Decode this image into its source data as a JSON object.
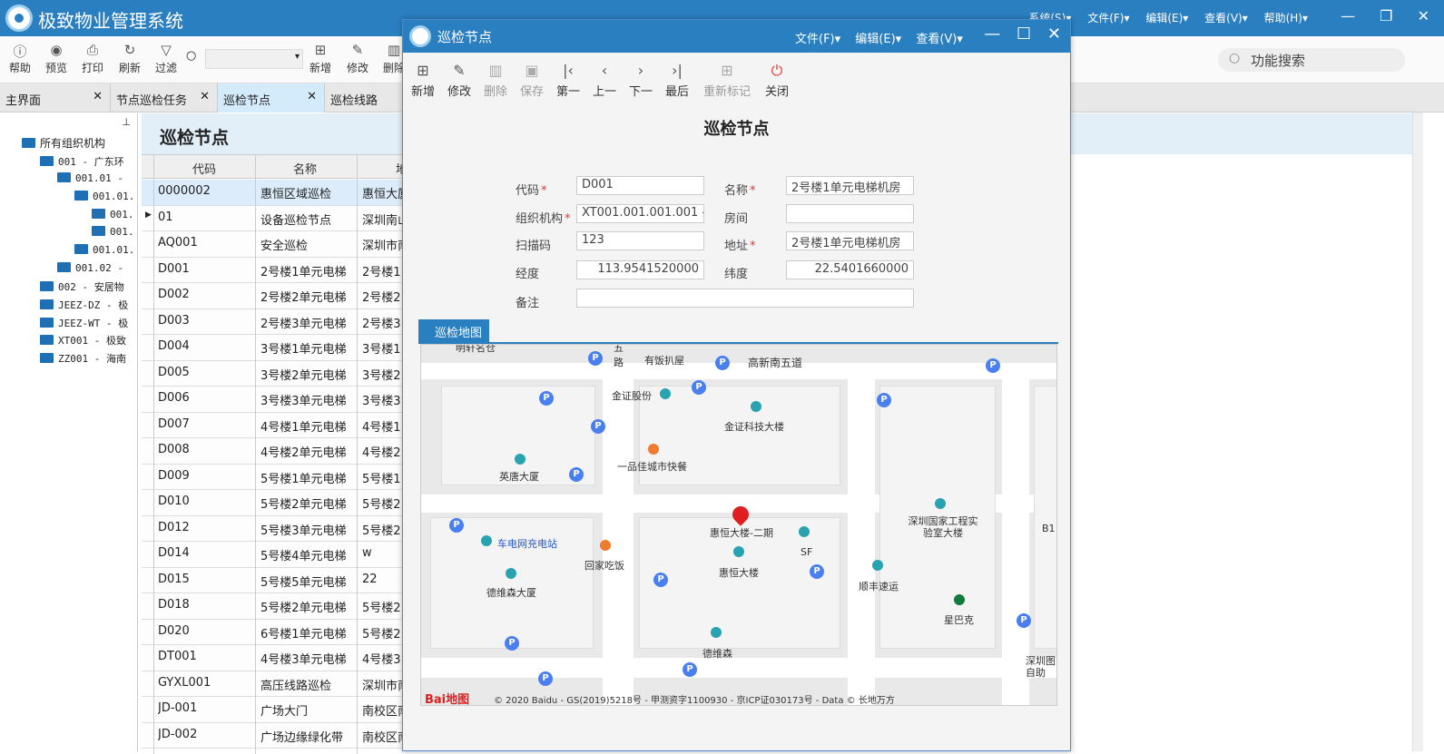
{
  "app": {
    "title": "极致物业管理系统",
    "menu": [
      "系统(S)▾",
      "文件(F)▾",
      "编辑(E)▾",
      "查看(V)▾",
      "帮助(H)▾"
    ],
    "window_controls": [
      "—",
      "❐",
      "✕"
    ]
  },
  "toolbar": {
    "help": "帮助",
    "preview": "预览",
    "print": "打印",
    "refresh": "刷新",
    "filter": "过滤",
    "new": "新增",
    "edit": "修改",
    "delete": "删除",
    "function_search": "功能搜索"
  },
  "tabs": [
    "主界面",
    "节点巡检任务",
    "巡检节点",
    "巡检线路"
  ],
  "tree": {
    "root": "所有组织机构",
    "nodes": [
      "001 - 广东环",
      "001.01 -",
      "001.01.",
      "001.",
      "001.",
      "001.01.",
      "001.02 -",
      "002 - 安居物",
      "JEEZ-DZ - 极",
      "JEEZ-WT - 极",
      "XT001 - 极致",
      "ZZ001 - 海南"
    ]
  },
  "main": {
    "title": "巡检节点",
    "columns": [
      "代码",
      "名称",
      "地"
    ],
    "rows": [
      [
        "0000002",
        "惠恒区域巡检",
        "惠恒大厦"
      ],
      [
        "01",
        "设备巡检节点",
        "深圳南山"
      ],
      [
        "AQ001",
        "安全巡检",
        "深圳市南"
      ],
      [
        "D001",
        "2号楼1单元电梯",
        "2号楼1"
      ],
      [
        "D002",
        "2号楼2单元电梯",
        "2号楼2"
      ],
      [
        "D003",
        "2号楼3单元电梯",
        "2号楼3"
      ],
      [
        "D004",
        "3号楼1单元电梯",
        "3号楼1"
      ],
      [
        "D005",
        "3号楼2单元电梯",
        "3号楼2"
      ],
      [
        "D006",
        "3号楼3单元电梯",
        "3号楼3"
      ],
      [
        "D007",
        "4号楼1单元电梯",
        "4号楼1"
      ],
      [
        "D008",
        "4号楼2单元电梯",
        "4号楼2"
      ],
      [
        "D009",
        "5号楼1单元电梯",
        "5号楼1"
      ],
      [
        "D010",
        "5号楼2单元电梯",
        "5号楼2"
      ],
      [
        "D012",
        "5号楼3单元电梯",
        "5号楼2"
      ],
      [
        "D014",
        "5号楼4单元电梯",
        "w"
      ],
      [
        "D015",
        "5号楼5单元电梯",
        "22"
      ],
      [
        "D018",
        "5号楼2单元电梯",
        "5号楼2"
      ],
      [
        "D020",
        "6号楼1单元电梯",
        "5号楼2"
      ],
      [
        "DT001",
        "4号楼3单元电梯",
        "4号楼3"
      ],
      [
        "GYXL001",
        "高压线路巡检",
        "深圳市南"
      ],
      [
        "JD-001",
        "广场大门",
        "南校区南"
      ],
      [
        "JD-002",
        "广场边缘绿化带",
        "南校区南"
      ]
    ]
  },
  "dialog": {
    "title": "巡检节点",
    "menu": [
      "文件(F)▾",
      "编辑(E)▾",
      "查看(V)▾"
    ],
    "controls": [
      "—",
      "☐",
      "✕"
    ],
    "tools": [
      "新增",
      "修改",
      "删除",
      "保存",
      "第一",
      "上一",
      "下一",
      "最后",
      "重新标记",
      "关闭"
    ],
    "form_title": "巡检节点",
    "labels": {
      "code": "代码",
      "name": "名称",
      "org": "组织机构",
      "room": "房间",
      "scan": "扫描码",
      "address": "地址",
      "lng": "经度",
      "lat": "纬度",
      "note": "备注"
    },
    "values": {
      "code": "D001",
      "name": "2号楼1单元电梯机房",
      "org": "XT001.001.001.001 -",
      "room": "",
      "scan": "123",
      "address": "2号楼1单元电梯机房",
      "lng": "113.9541520000",
      "lat": "22.5401660000",
      "note": ""
    },
    "map_tab": "巡检地图",
    "map": {
      "labels": [
        "明轩名仓",
        "五路",
        "有饭扒屋",
        "高新南五道",
        "金证股份",
        "金证科技大楼",
        "一品佳城市快餐",
        "英唐大厦",
        "惠恒大楼-二期",
        "SF",
        "惠恒大楼",
        "车电网充电站",
        "回家吃饭",
        "德维森大厦",
        "德维森",
        "深圳国家工程实验室大楼",
        "顺丰速运",
        "星巴克",
        "深圳图自助",
        "B1"
      ],
      "baidu": "Bai地图",
      "copyright": "© 2020 Baidu - GS(2019)5218号 - 甲测资字1100930 - 京ICP证030173号 - Data © 长地万方"
    }
  }
}
